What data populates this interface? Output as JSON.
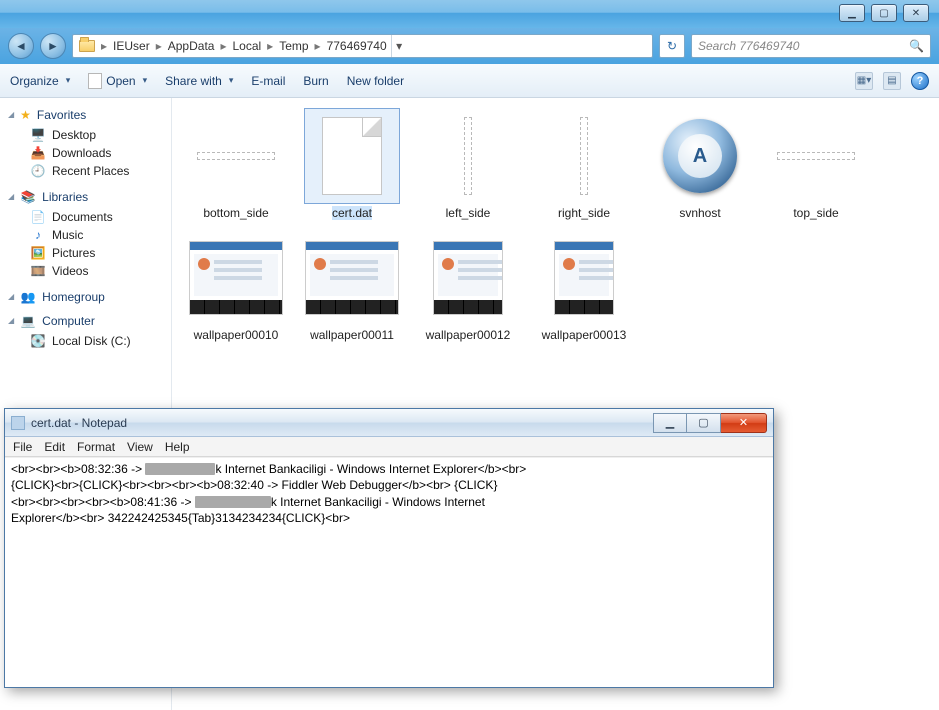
{
  "titlebar": {
    "min": "▁",
    "max": "▢",
    "close": "✕"
  },
  "nav": {
    "back": "◄",
    "forward": "►"
  },
  "breadcrumb": {
    "parts": [
      "IEUser",
      "AppData",
      "Local",
      "Temp",
      "776469740"
    ]
  },
  "search": {
    "placeholder": "Search 776469740"
  },
  "toolbar": {
    "organize": "Organize",
    "open": "Open",
    "share": "Share with",
    "email": "E-mail",
    "burn": "Burn",
    "newfolder": "New folder"
  },
  "sidebar": {
    "favorites": {
      "label": "Favorites",
      "items": [
        "Desktop",
        "Downloads",
        "Recent Places"
      ]
    },
    "libraries": {
      "label": "Libraries",
      "items": [
        "Documents",
        "Music",
        "Pictures",
        "Videos"
      ]
    },
    "homegroup": {
      "label": "Homegroup"
    },
    "computer": {
      "label": "Computer",
      "items": [
        "Local Disk (C:)"
      ]
    }
  },
  "files": {
    "r1": [
      {
        "name": "bottom_side"
      },
      {
        "name": "cert.dat"
      },
      {
        "name": "left_side"
      },
      {
        "name": "right_side"
      },
      {
        "name": "svnhost"
      },
      {
        "name": "top_side"
      },
      {
        "name": "wallpaper00010"
      }
    ],
    "r2": [
      {
        "name": "wallpaper00011"
      },
      {
        "name": "wallpaper00012"
      },
      {
        "name": "wallpaper00013"
      }
    ]
  },
  "notepad": {
    "title": "cert.dat - Notepad",
    "menu": [
      "File",
      "Edit",
      "Format",
      "View",
      "Help"
    ],
    "lines": {
      "l1a": "<br><br><b>08:32:36 -> ",
      "l1b": "k Internet Bankaciligi - Windows Internet Explorer</b><br>",
      "l2": "{CLICK}<br>{CLICK}<br><br><br><b>08:32:40 -> Fiddler Web Debugger</b><br> {CLICK}",
      "l3a": "<br><br><br><br><b>08:41:36 -> ",
      "l3b": "k Internet Bankaciligi - Windows Internet",
      "l4": "Explorer</b><br> 342242425345{Tab}3134234234{CLICK}<br>"
    },
    "ctrl": {
      "min": "▁",
      "max": "▢",
      "close": "✕"
    }
  }
}
